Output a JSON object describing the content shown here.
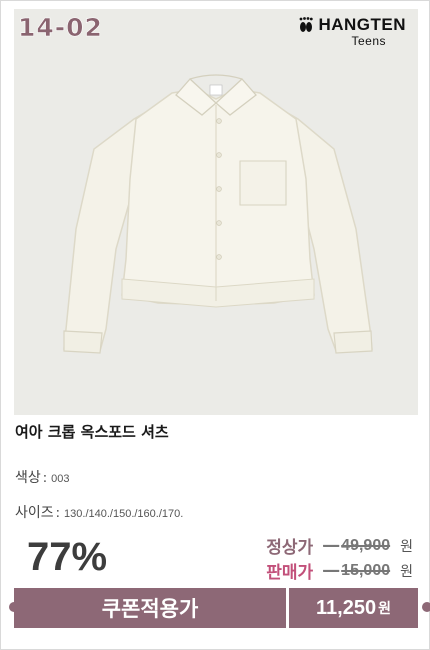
{
  "product": {
    "code": "14-02",
    "brand": {
      "name": "HANGTEN",
      "sub": "Teens"
    },
    "title": "여아 크롭 옥스포드 셔츠",
    "color_label": "색상",
    "color_value": "003",
    "size_label": "사이즈",
    "size_value": "130./140./150./160./170.",
    "discount": "77%",
    "regular_label": "정상가",
    "regular_price": "49,900",
    "sale_label": "판매가",
    "sale_price": "15,000",
    "won": "원",
    "coupon_label": "쿠폰적용가",
    "final_price": "11,250",
    "final_won": "원"
  },
  "colors": {
    "accent": "#8d6876",
    "code_text": "#8a6470",
    "regular_label": "#8d6876",
    "sale_label": "#c2507a",
    "photo_bg": "#ebebe7"
  }
}
